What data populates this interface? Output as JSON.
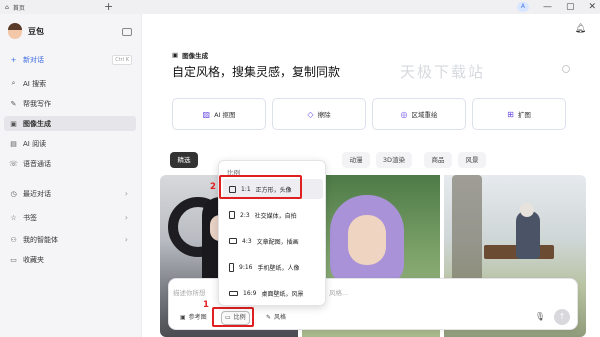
{
  "window": {
    "tab_title": "首页",
    "new_tab": "+",
    "avatar_letter": "A",
    "controls": [
      "—",
      "▢",
      "✕"
    ]
  },
  "sidebar": {
    "app_name": "豆包",
    "items": [
      {
        "label": "新对话",
        "icon": "plus-icon",
        "shortcut": "Ctrl K"
      },
      {
        "label": "AI 搜索",
        "icon": "search-icon"
      },
      {
        "label": "帮我写作",
        "icon": "pen-icon"
      },
      {
        "label": "图像生成",
        "icon": "image-icon"
      },
      {
        "label": "AI 阅读",
        "icon": "book-icon"
      },
      {
        "label": "语音通话",
        "icon": "phone-icon"
      },
      {
        "label": "最近对话",
        "icon": "clock-icon"
      },
      {
        "label": "书签",
        "icon": "bookmark-icon"
      },
      {
        "label": "我的智能体",
        "icon": "agent-icon"
      },
      {
        "label": "收藏夹",
        "icon": "folder-icon"
      }
    ]
  },
  "main": {
    "section_label": "图像生成",
    "headline": "自定风格，搜集灵感，复制同款",
    "watermark": "天极下载站",
    "tools": [
      {
        "label": "AI 抠图"
      },
      {
        "label": "擦除"
      },
      {
        "label": "区域重绘"
      },
      {
        "label": "扩图"
      }
    ],
    "filters": [
      "精选",
      "动漫",
      "3D渲染",
      "商品",
      "风景"
    ],
    "input": {
      "placeholder": "描述你所想",
      "placeholder_tail": "风格...",
      "chips": [
        "参考图",
        "比例",
        "风格"
      ]
    },
    "ratio_menu": {
      "title": "比例",
      "options": [
        {
          "value": "1:1",
          "label": "正方形，头像"
        },
        {
          "value": "2:3",
          "label": "社交媒体，自拍"
        },
        {
          "value": "4:3",
          "label": "文章配图，插画"
        },
        {
          "value": "9:16",
          "label": "手机壁纸，人像"
        },
        {
          "value": "16:9",
          "label": "桌面壁纸，风景"
        }
      ]
    },
    "annotations": [
      "1",
      "2"
    ]
  }
}
